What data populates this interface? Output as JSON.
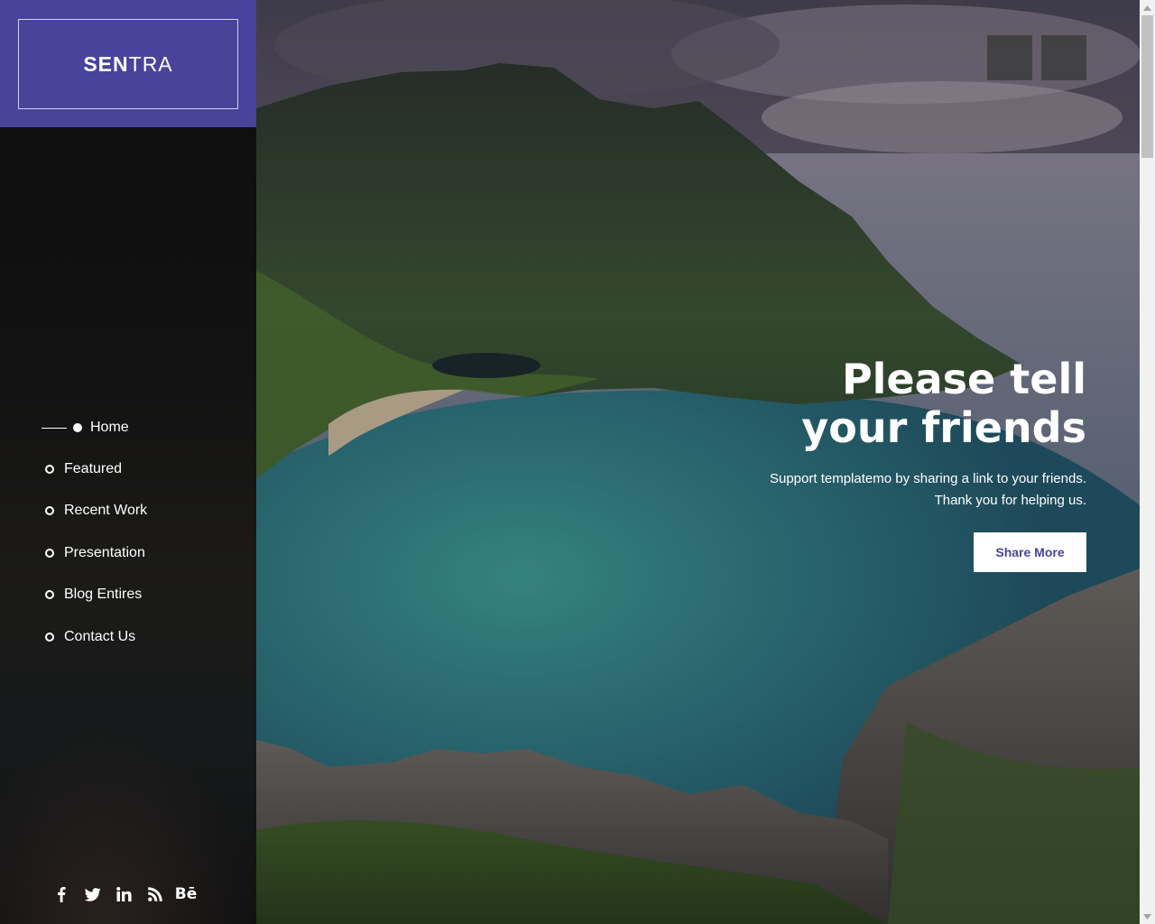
{
  "brand": {
    "bold": "SEN",
    "light": "TRA"
  },
  "nav": {
    "items": [
      {
        "label": "Home",
        "active": true
      },
      {
        "label": "Featured"
      },
      {
        "label": "Recent Work"
      },
      {
        "label": "Presentation"
      },
      {
        "label": "Blog Entires"
      },
      {
        "label": "Contact Us"
      }
    ]
  },
  "social": {
    "behance_text": "Bē",
    "icons": [
      "facebook-icon",
      "twitter-icon",
      "linkedin-icon",
      "rss-icon",
      "behance-icon"
    ]
  },
  "hero": {
    "title_line1": "Please tell",
    "title_line2": "your friends",
    "subtitle_line1": "Support templatemo by sharing a link to your friends.",
    "subtitle_line2": "Thank you for helping us.",
    "button_label": "Share More"
  },
  "slider": {
    "prev_icon": "chevron-left-icon",
    "next_icon": "chevron-right-icon"
  },
  "colors": {
    "accent": "#48449c",
    "sidebar": "#121212",
    "text": "#ffffff"
  }
}
